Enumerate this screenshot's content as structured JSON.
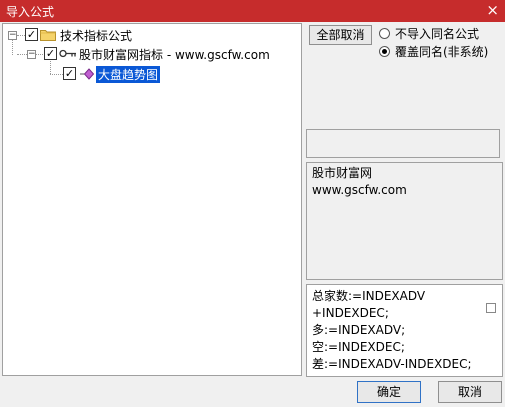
{
  "window": {
    "title": "导入公式",
    "close_glyph": "×"
  },
  "tree": {
    "root": {
      "label": "技术指标公式",
      "checked": true,
      "expand": "−"
    },
    "group": {
      "label": "股市财富网指标 - www.gscfw.com",
      "checked": true,
      "expand": "−"
    },
    "item": {
      "label": "大盘趋势图",
      "checked": true
    }
  },
  "options": {
    "cancel_all_label": "全部取消",
    "radio_skip_label": "不导入同名公式",
    "radio_overwrite_label": "覆盖同名(非系统)",
    "selected": "overwrite"
  },
  "description": {
    "lines": [
      "股市财富网",
      "www.gscfw.com"
    ]
  },
  "formula": {
    "lines": [
      "总家数:=INDEXADV",
      "+INDEXDEC;",
      "多:=INDEXADV;",
      "空:=INDEXDEC;",
      "差:=INDEXADV-INDEXDEC;"
    ]
  },
  "buttons": {
    "ok_label": "确定",
    "cancel_label": "取消"
  },
  "icons": {
    "folder": "folder-icon",
    "key": "key-icon",
    "formula": "formula-diamond-icon",
    "check": "✓"
  }
}
